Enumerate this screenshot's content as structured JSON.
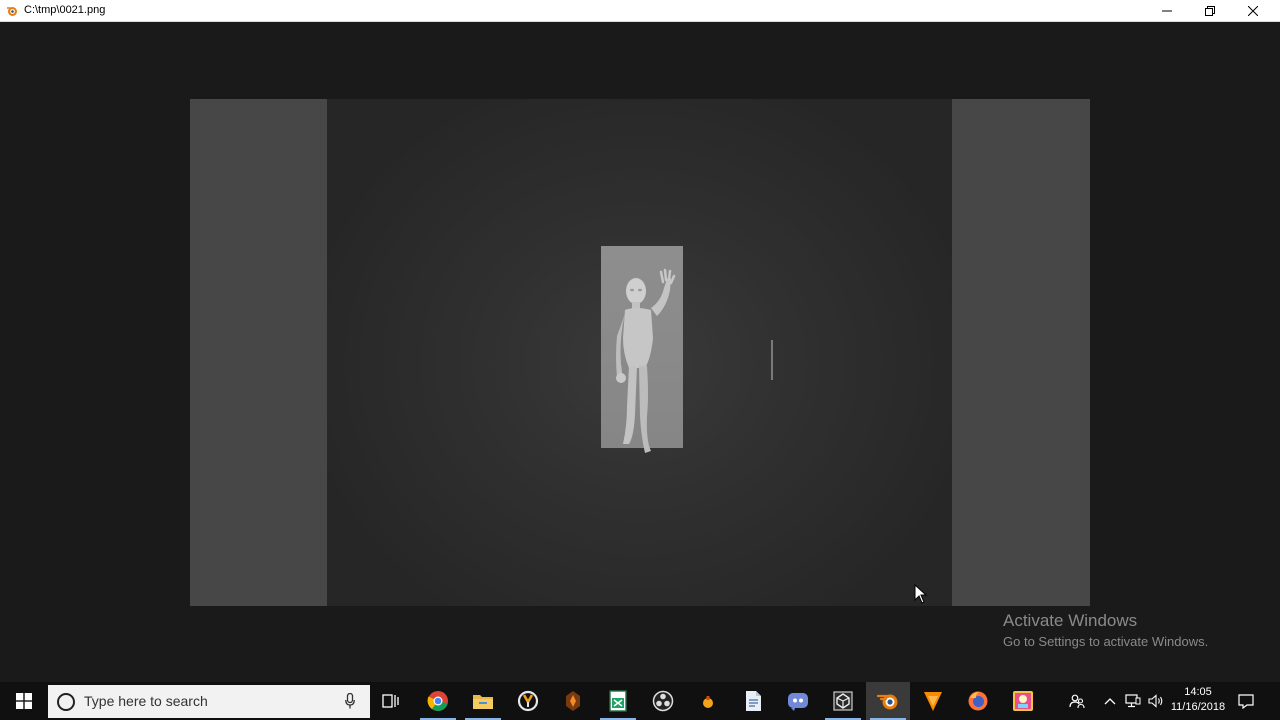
{
  "window": {
    "title": "C:\\tmp\\0021.png",
    "app_icon": "blender-icon",
    "controls": [
      "minimize-icon",
      "restore-icon",
      "close-icon"
    ]
  },
  "watermark": {
    "title": "Activate Windows",
    "subtitle": "Go to Settings to activate Windows."
  },
  "taskbar": {
    "search_placeholder": "Type here to search",
    "pinned": [
      {
        "name": "task-view-icon"
      },
      {
        "name": "chrome-icon"
      },
      {
        "name": "file-explorer-icon"
      },
      {
        "name": "overwatch-icon"
      },
      {
        "name": "game-launcher-icon"
      },
      {
        "name": "spreadsheet-icon"
      },
      {
        "name": "obs-icon"
      },
      {
        "name": "tray-app-icon"
      },
      {
        "name": "document-icon"
      },
      {
        "name": "discord-icon"
      },
      {
        "name": "unity-icon"
      },
      {
        "name": "blender-icon"
      },
      {
        "name": "vlc-icon"
      },
      {
        "name": "firefox-icon"
      },
      {
        "name": "photo-app-icon"
      }
    ],
    "tray": [
      "people-icon",
      "chevron-up-icon",
      "network-icon",
      "volume-icon"
    ],
    "clock": {
      "time": "14:05",
      "date": "11/16/2018"
    },
    "notification_icon": "action-center-icon"
  }
}
